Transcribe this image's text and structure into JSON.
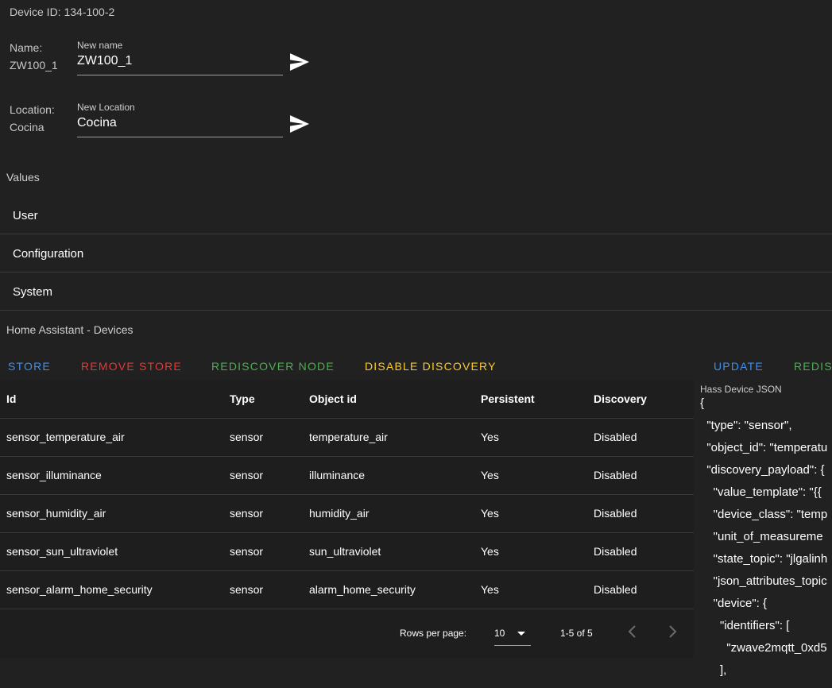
{
  "device": {
    "id_label": "Device ID: 134-100-2",
    "name_label": "Name:",
    "name_value": "ZW100_1",
    "new_name_label": "New name",
    "new_name_value": "ZW100_1",
    "location_label": "Location:",
    "location_value": "Cocina",
    "new_location_label": "New Location",
    "new_location_value": "Cocina"
  },
  "values": {
    "title": "Values",
    "panels": [
      "User",
      "Configuration",
      "System"
    ]
  },
  "hass": {
    "title": "Home Assistant - Devices",
    "actions": {
      "store": "STORE",
      "remove_store": "REMOVE STORE",
      "rediscover_node": "REDISCOVER NODE",
      "disable_discovery": "DISABLE DISCOVERY",
      "update": "UPDATE",
      "rediscover": "REDIS"
    },
    "colors": {
      "store": "#3f8ff2",
      "remove_store": "#e53935",
      "rediscover_node": "#4caf50",
      "disable_discovery": "#ffca28",
      "update": "#3f8ff2",
      "rediscover": "#4caf50"
    },
    "table": {
      "headers": [
        "Id",
        "Type",
        "Object id",
        "Persistent",
        "Discovery"
      ],
      "rows": [
        [
          "sensor_temperature_air",
          "sensor",
          "temperature_air",
          "Yes",
          "Disabled"
        ],
        [
          "sensor_illuminance",
          "sensor",
          "illuminance",
          "Yes",
          "Disabled"
        ],
        [
          "sensor_humidity_air",
          "sensor",
          "humidity_air",
          "Yes",
          "Disabled"
        ],
        [
          "sensor_sun_ultraviolet",
          "sensor",
          "sun_ultraviolet",
          "Yes",
          "Disabled"
        ],
        [
          "sensor_alarm_home_security",
          "sensor",
          "alarm_home_security",
          "Yes",
          "Disabled"
        ]
      ],
      "rows_per_page_label": "Rows per page:",
      "rows_per_page_value": "10",
      "page_info": "1-5 of 5"
    },
    "json_label": "Hass Device JSON",
    "json_lines": [
      "{",
      "  \"type\": \"sensor\",",
      "  \"object_id\": \"temperatu",
      "  \"discovery_payload\": {",
      "    \"value_template\": \"{{ ",
      "    \"device_class\": \"temp",
      "    \"unit_of_measureme",
      "    \"state_topic\": \"jlgalinh",
      "    \"json_attributes_topic",
      "    \"device\": {",
      "      \"identifiers\": [",
      "        \"zwave2mqtt_0xd5",
      "      ],"
    ]
  }
}
